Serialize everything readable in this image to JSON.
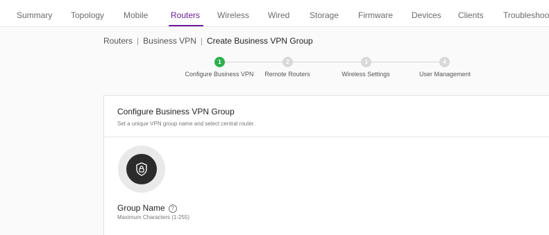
{
  "nav": {
    "tabs": [
      {
        "label": "Summary"
      },
      {
        "label": "Topology"
      },
      {
        "label": "Mobile"
      },
      {
        "label": "Routers"
      },
      {
        "label": "Wireless"
      },
      {
        "label": "Wired"
      },
      {
        "label": "Storage"
      },
      {
        "label": "Firmware"
      },
      {
        "label": "Devices"
      },
      {
        "label": "Clients"
      },
      {
        "label": "Troubleshoot"
      }
    ],
    "active": "Routers",
    "accent": "#6a1b9a"
  },
  "breadcrumb": {
    "routers": "Routers",
    "sep1": "|",
    "business_vpn": "Business VPN",
    "sep2": "|",
    "current": "Create Business VPN Group"
  },
  "stepper": {
    "steps": [
      {
        "num": "1",
        "label": "Configure Business VPN",
        "state": "done"
      },
      {
        "num": "2",
        "label": "Remote Routers",
        "state": "todo"
      },
      {
        "num": "3",
        "label": "Wireless Settings",
        "state": "todo"
      },
      {
        "num": "4",
        "label": "User Management",
        "state": "todo"
      }
    ],
    "done_color": "#2fb04f",
    "todo_color": "#d9d9d9"
  },
  "card": {
    "title": "Configure Business VPN Group",
    "subtitle": "Set a unique VPN group name and select central router.",
    "icon": "vpn-shield-lock-icon",
    "group_name_label": "Group Name",
    "help_glyph": "?",
    "group_name_hint": "Maximum Characters (1-255)"
  }
}
